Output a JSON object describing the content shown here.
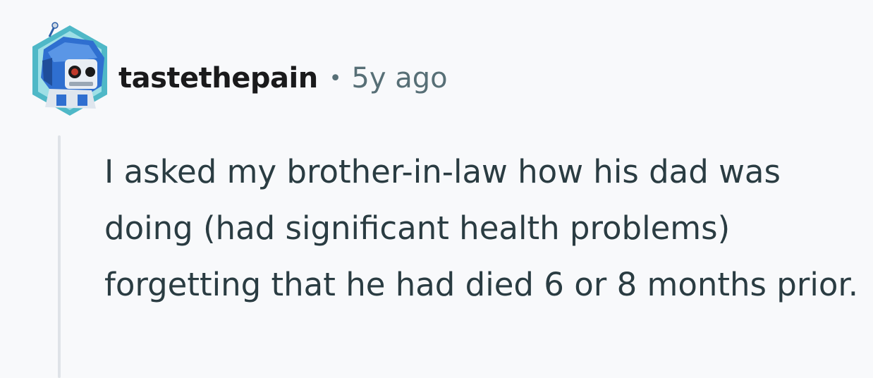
{
  "comment": {
    "author": "tastethepain",
    "separator": "•",
    "timestamp": "5y ago",
    "avatar_icon": "snoo-robot-avatar-icon",
    "body": "I asked my brother-in-law how his dad was doing (had significant health problems) forgetting that he had died 6 or 8 months prior."
  },
  "colors": {
    "background": "#f8f9fb",
    "avatar_frame": "#4fb8c7",
    "avatar_blue": "#2f6fd0",
    "meta_text": "#576f76",
    "body_text": "#2a3c42",
    "thread_line": "#dfe3e8"
  }
}
